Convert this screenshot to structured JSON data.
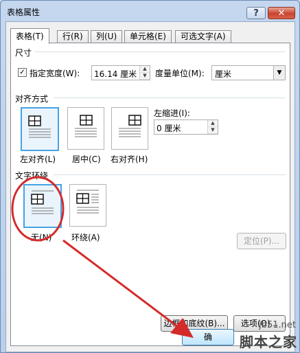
{
  "window": {
    "title": "表格属性",
    "help_icon": "?",
    "close_icon": "✕"
  },
  "tabs": [
    {
      "label": "表格(T)",
      "active": true
    },
    {
      "label": "行(R)",
      "active": false
    },
    {
      "label": "列(U)",
      "active": false
    },
    {
      "label": "单元格(E)",
      "active": false
    },
    {
      "label": "可选文字(A)",
      "active": false
    }
  ],
  "size": {
    "section_label": "尺寸",
    "preferred_width_label": "指定宽度(W):",
    "preferred_width_checked": true,
    "preferred_width_value": "16.14 厘米",
    "measure_in_label": "度量单位(M):",
    "measure_in_value": "厘米"
  },
  "alignment": {
    "section_label": "对齐方式",
    "options": [
      {
        "label": "左对齐(L)",
        "selected": true
      },
      {
        "label": "居中(C)",
        "selected": false
      },
      {
        "label": "右对齐(H)",
        "selected": false
      }
    ],
    "indent_label": "左缩进(I):",
    "indent_value": "0 厘米"
  },
  "wrapping": {
    "section_label": "文字环绕",
    "options": [
      {
        "label": "无(N)",
        "selected": true
      },
      {
        "label": "环绕(A)",
        "selected": false
      }
    ],
    "positioning_label": "定位(P)..."
  },
  "buttons": {
    "borders_label": "边框和底纹(B)...",
    "options_label": "选项(O)...",
    "ok_label": "确"
  },
  "watermark": {
    "site": "jb51.net",
    "brand": "脚本之家"
  },
  "colors": {
    "annotation": "#d42a2a",
    "selected_border": "#46a2e3"
  }
}
